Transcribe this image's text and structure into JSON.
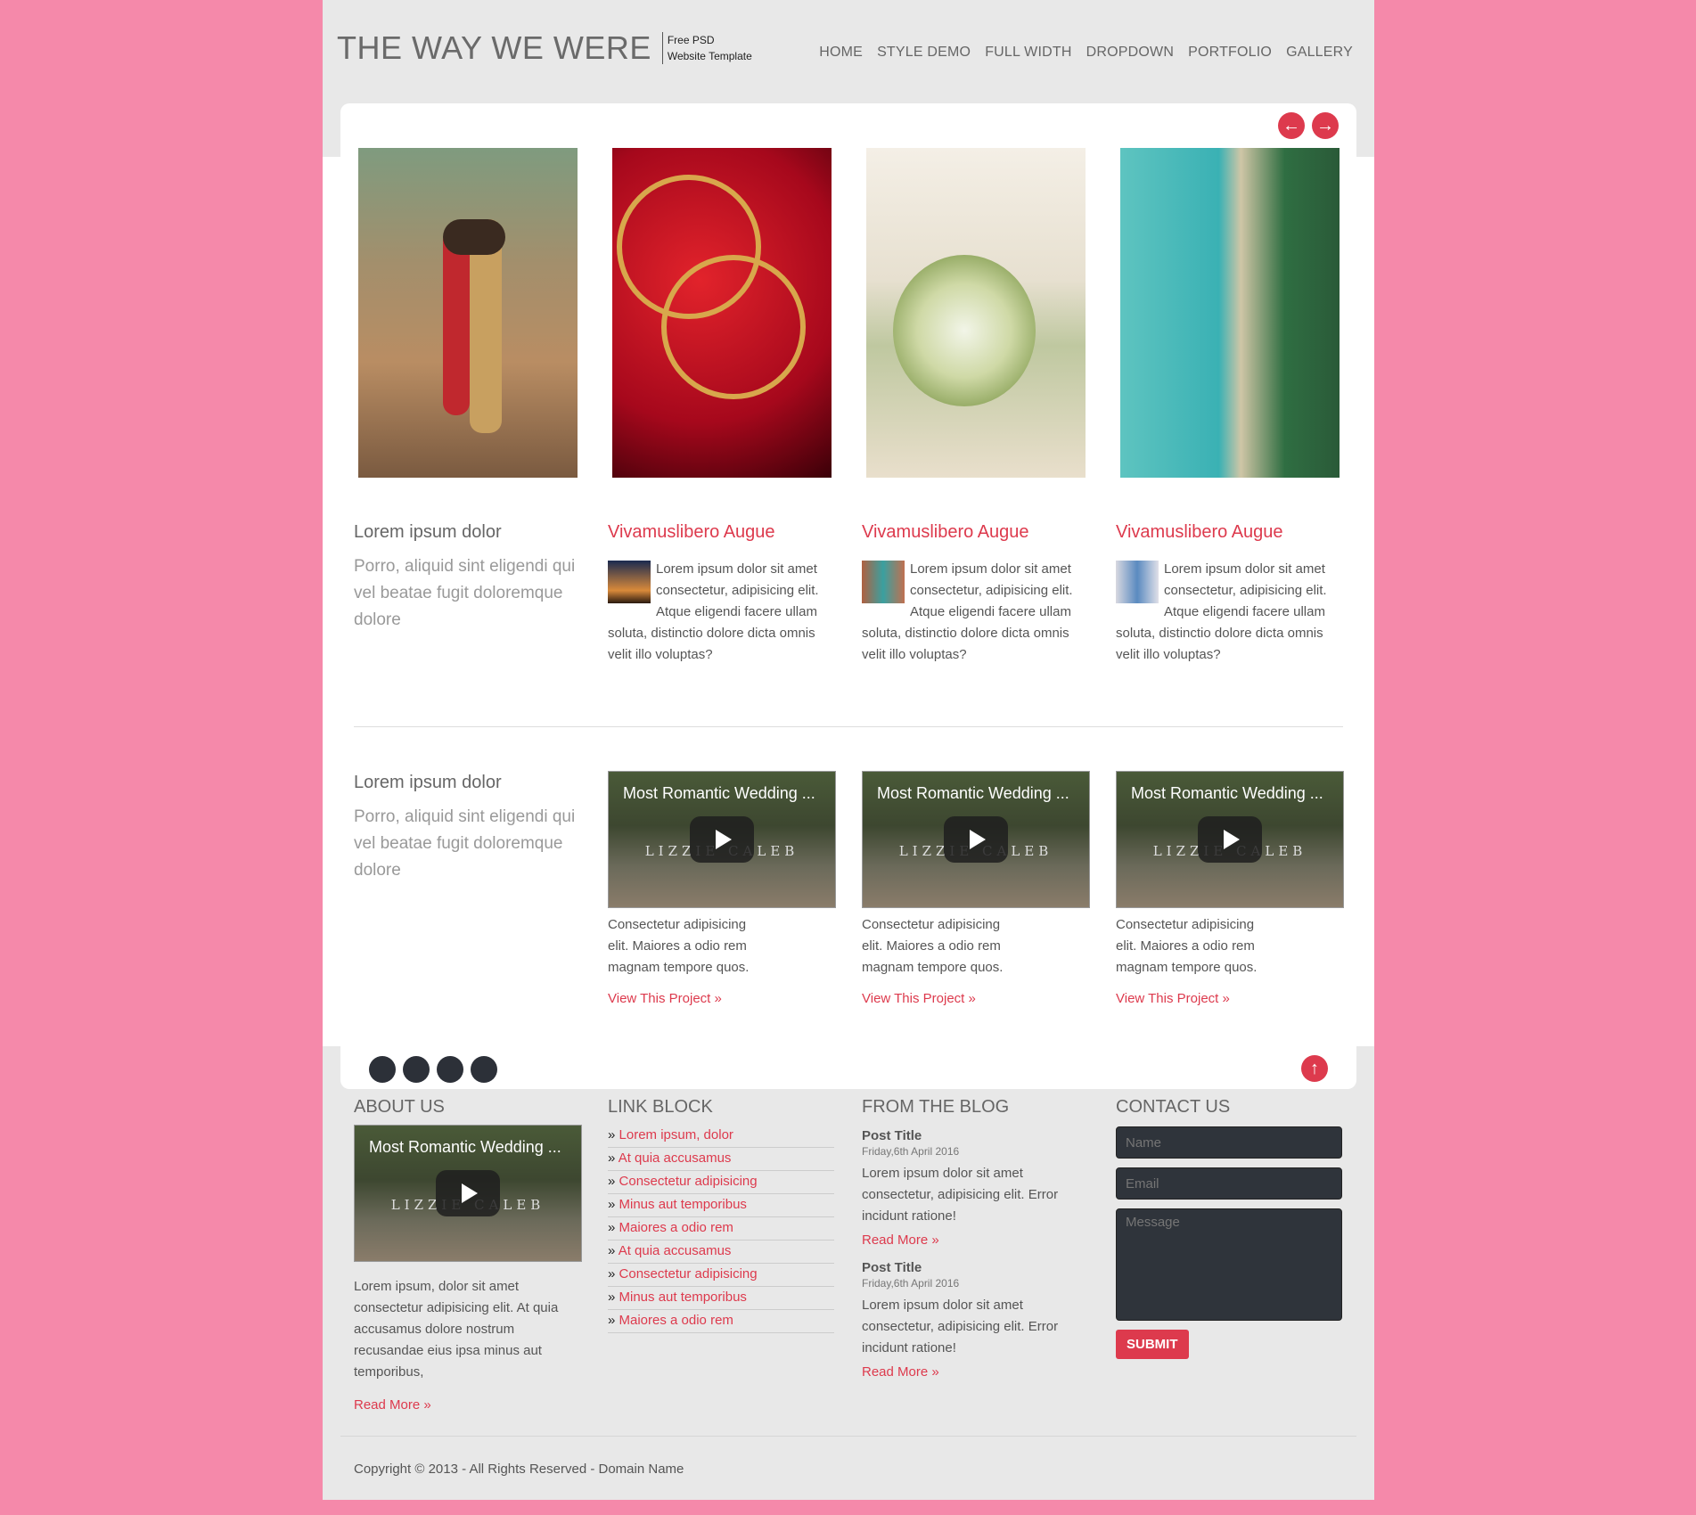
{
  "header": {
    "logo_title": "THE WAY WE WERE",
    "logo_sub_1": "Free PSD",
    "logo_sub_2": "Website Template",
    "nav": [
      "HOME",
      "STYLE DEMO",
      "FULL WIDTH",
      "DROPDOWN",
      "PORTFOLIO",
      "GALLERY"
    ]
  },
  "slider": {
    "prev_icon": "arrow-left-icon",
    "next_icon": "arrow-right-icon"
  },
  "features": {
    "intro_title": "Lorem ipsum dolor",
    "intro_text": "Porro, aliquid sint eligendi qui vel beatae fugit doloremque dolore",
    "items": [
      {
        "title": "Vivamuslibero Augue",
        "text": "Lorem ipsum dolor sit amet consectetur, adipisicing elit. Atque eligendi facere ullam soluta, distinctio dolore dicta omnis velit illo voluptas?"
      },
      {
        "title": "Vivamuslibero Augue",
        "text": "Lorem ipsum dolor sit amet consectetur, adipisicing elit. Atque eligendi facere ullam soluta, distinctio dolore dicta omnis velit illo voluptas?"
      },
      {
        "title": "Vivamuslibero Augue",
        "text": "Lorem ipsum dolor sit amet consectetur, adipisicing elit. Atque eligendi facere ullam soluta, distinctio dolore dicta omnis velit illo voluptas?"
      }
    ]
  },
  "projects": {
    "intro_title": "Lorem ipsum dolor",
    "intro_text": "Porro, aliquid sint eligendi qui vel beatae fugit doloremque dolore",
    "video_title": "Most Romantic Wedding ...",
    "video_names": "LIZZIE CALEB",
    "items": [
      {
        "caption": "Consectetur adipisicing elit. Maiores a odio rem magnam tempore quos.",
        "link": "View This Project »"
      },
      {
        "caption": "Consectetur adipisicing elit. Maiores a odio rem magnam tempore quos.",
        "link": "View This Project »"
      },
      {
        "caption": "Consectetur adipisicing elit. Maiores a odio rem magnam tempore quos.",
        "link": "View This Project »"
      }
    ]
  },
  "footer": {
    "about": {
      "title": "ABOUT US",
      "video_title": "Most Romantic Wedding ...",
      "video_names": "LIZZIE CALEB",
      "text": "Lorem ipsum, dolor sit amet consectetur adipisicing elit. At quia accusamus dolore nostrum recusandae eius ipsa minus aut temporibus,",
      "link": "Read More »"
    },
    "links": {
      "title": "LINK BLOCK",
      "items": [
        "Lorem ipsum, dolor",
        "At quia accusamus",
        "Consectetur adipisicing",
        "Minus aut temporibus",
        "Maiores a odio rem",
        "At quia accusamus",
        "Consectetur adipisicing",
        "Minus aut temporibus",
        "Maiores a odio rem"
      ]
    },
    "blog": {
      "title": "FROM THE BLOG",
      "posts": [
        {
          "title": "Post Title",
          "date": "Friday,6th April 2016",
          "text": "Lorem ipsum dolor sit amet consectetur, adipisicing elit. Error incidunt ratione!",
          "link": "Read More »"
        },
        {
          "title": "Post Title",
          "date": "Friday,6th April 2016",
          "text": "Lorem ipsum dolor sit amet consectetur, adipisicing elit. Error incidunt ratione!",
          "link": "Read More »"
        }
      ]
    },
    "contact": {
      "title": "CONTACT US",
      "name_placeholder": "Name",
      "email_placeholder": "Email",
      "message_placeholder": "Message",
      "submit": "SUBMIT"
    },
    "copyright": "Copyright © 2013 - All Rights Reserved - Domain Name"
  },
  "colors": {
    "accent": "#dd3a4d",
    "background": "#f589aa",
    "page": "#e8e8e8",
    "dark": "#2c3038"
  }
}
